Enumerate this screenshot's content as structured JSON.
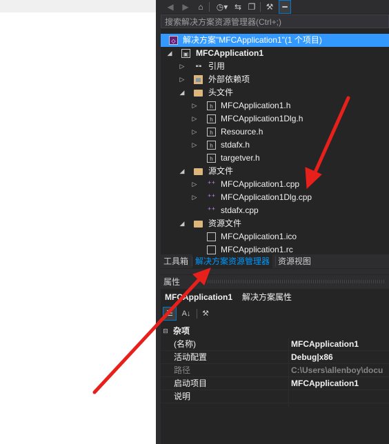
{
  "toolbar": {
    "icons": [
      "back-icon",
      "forward-icon",
      "home-icon",
      "history-icon",
      "sync-icon",
      "collapse-all-icon",
      "properties-icon",
      "pin-icon"
    ]
  },
  "search": {
    "placeholder": "搜索解决方案资源管理器(Ctrl+;)"
  },
  "tree": {
    "solution": "解决方案\"MFCApplication1\"(1 个项目)",
    "project": "MFCApplication1",
    "references": "引用",
    "external_deps": "外部依赖项",
    "header_folder": "头文件",
    "headers": [
      "MFCApplication1.h",
      "MFCApplication1Dlg.h",
      "Resource.h",
      "stdafx.h",
      "targetver.h"
    ],
    "source_folder": "源文件",
    "sources": [
      "MFCApplication1.cpp",
      "MFCApplication1Dlg.cpp",
      "stdafx.cpp"
    ],
    "resource_folder": "资源文件",
    "resources": [
      "MFCApplication1.ico",
      "MFCApplication1.rc"
    ]
  },
  "tabs": [
    "工具箱",
    "解决方案资源管理器",
    "资源视图"
  ],
  "properties": {
    "title": "属性",
    "object_name": "MFCApplication1",
    "object_type": "解决方案属性",
    "category": "杂项",
    "rows": [
      {
        "name": "(名称)",
        "value": "MFCApplication1"
      },
      {
        "name": "活动配置",
        "value": "Debug|x86"
      },
      {
        "name": "路径",
        "value": "C:\\Users\\allenboy\\docu"
      },
      {
        "name": "启动项目",
        "value": "MFCApplication1"
      },
      {
        "name": "说明",
        "value": ""
      }
    ]
  },
  "colors": {
    "panel_bg": "#252526",
    "selection": "#3399ff",
    "active_tab_text": "#0097fb",
    "annotation_arrow": "#e8201c"
  }
}
